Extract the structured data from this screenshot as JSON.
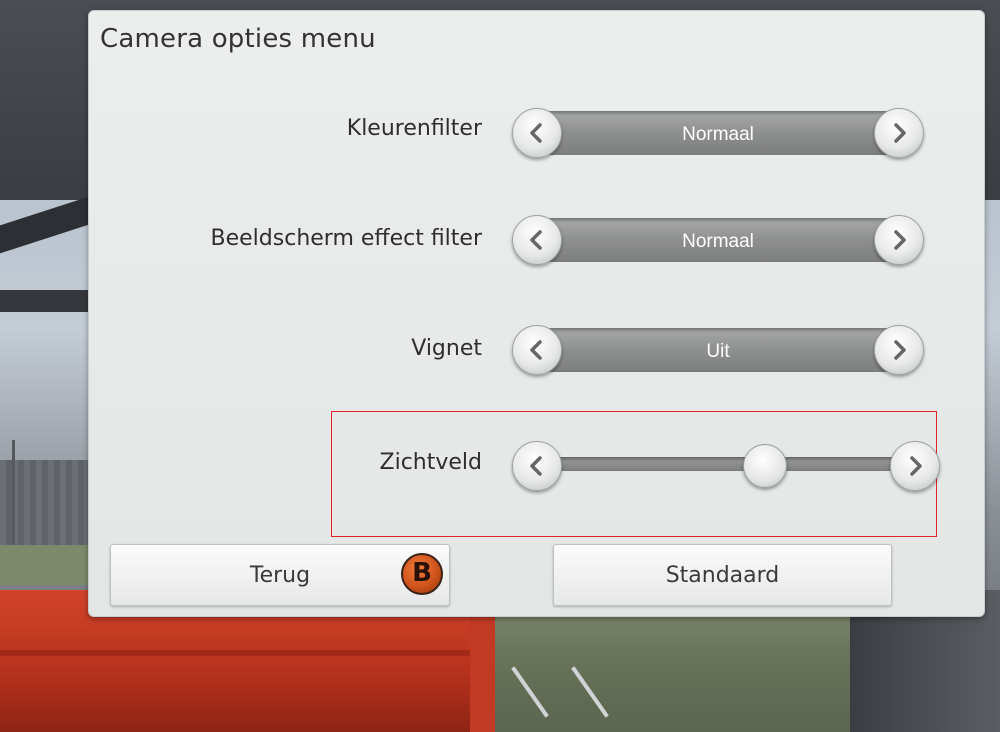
{
  "dialog": {
    "title": "Camera opties menu"
  },
  "settings": [
    {
      "label": "Kleurenfilter",
      "value": "Normaal"
    },
    {
      "label": "Beeldscherm effect filter",
      "value": "Normaal"
    },
    {
      "label": "Vignet",
      "value": "Uit"
    }
  ],
  "fov": {
    "label": "Zichtveld",
    "slider_level": 0.61
  },
  "buttons": {
    "back": "Terug",
    "back_badge": "B",
    "default": "Standaard"
  },
  "icons": {
    "prev": "chevron-left-icon",
    "next": "chevron-right-icon",
    "gamepad_b": "gamepad-b-icon"
  },
  "colors": {
    "highlight": "#e0242c",
    "badge": "#d0541c"
  }
}
